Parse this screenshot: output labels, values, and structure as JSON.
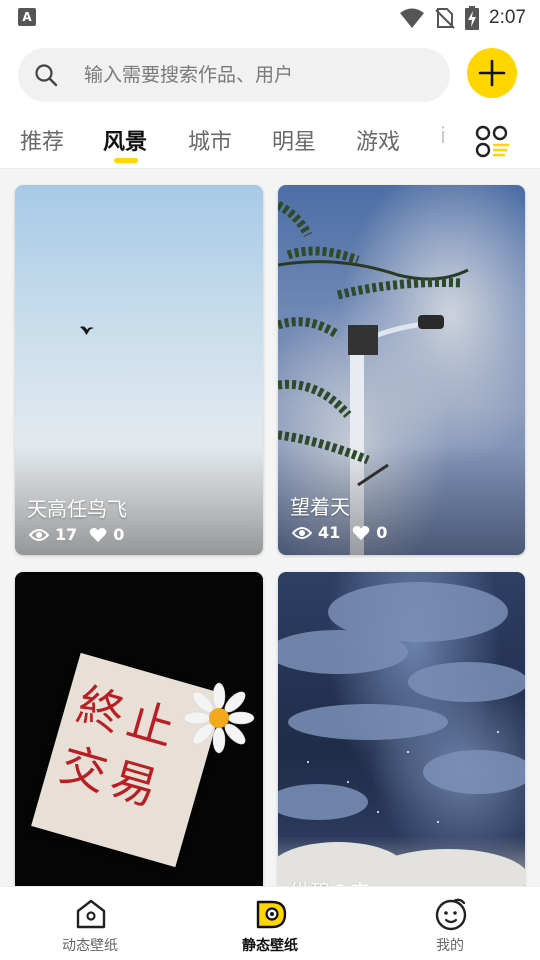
{
  "status_bar": {
    "app_badge": "A",
    "time": "2:07",
    "icons": [
      "wifi-icon",
      "no-sim-icon",
      "battery-charging-icon"
    ]
  },
  "search": {
    "placeholder": "输入需要搜索作品、用户",
    "icon": "search-icon"
  },
  "add_button": {
    "icon": "plus-icon",
    "color": "#ffd600"
  },
  "tabs": [
    {
      "label": "推荐",
      "active": false
    },
    {
      "label": "风景",
      "active": true
    },
    {
      "label": "城市",
      "active": false
    },
    {
      "label": "明星",
      "active": false
    },
    {
      "label": "游戏",
      "active": false
    },
    {
      "label": "i",
      "active": false
    }
  ],
  "category_grid_icon": "category-grid-icon",
  "accent_color": "#ffd600",
  "cards": [
    {
      "title": "天高任鸟飞",
      "views": "17",
      "likes": "0"
    },
    {
      "title": "望着天",
      "views": "41",
      "likes": "0"
    },
    {
      "title": "",
      "image_text": "終止交易"
    },
    {
      "title": "纵碧の空"
    }
  ],
  "bottom_nav": [
    {
      "label": "动态壁纸",
      "icon": "home-icon",
      "active": false
    },
    {
      "label": "静态壁纸",
      "icon": "wallpaper-icon",
      "active": true
    },
    {
      "label": "我的",
      "icon": "face-icon",
      "active": false
    }
  ]
}
